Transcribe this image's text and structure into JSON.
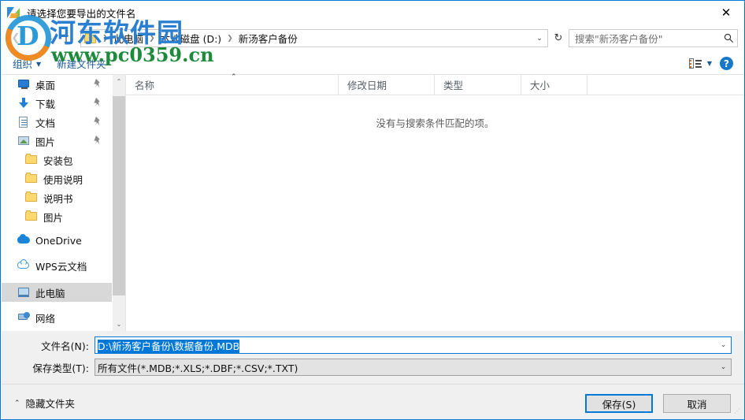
{
  "window": {
    "title": "请选择您要导出的文件名",
    "close_label": "✕",
    "app_icon": "app-icon"
  },
  "address_bar": {
    "back_icon": "back-arrow-icon",
    "forward_icon": "forward-arrow-icon",
    "recent_icon": "recent-locations-icon",
    "up_icon": "up-arrow-icon",
    "folder_icon": "folder-icon",
    "breadcrumbs": [
      "此电脑",
      "本地磁盘 (D:)",
      "新汤客户备份"
    ],
    "separator": "❯",
    "dropdown_icon": "chevron-down-icon",
    "refresh_icon": "refresh-icon",
    "refresh_glyph": "↻"
  },
  "search": {
    "placeholder": "搜索\"新汤客户备份\"",
    "icon": "search-icon",
    "glyph": "⌕"
  },
  "toolbar": {
    "organize_label": "组织",
    "organize_caret": "▼",
    "new_folder_label": "新建文件夹",
    "view_icon": "view-layout-icon",
    "view_caret": "▼",
    "help_label": "?",
    "help_icon": "help-icon"
  },
  "sidebar": {
    "items": [
      {
        "label": "桌面",
        "icon": "desktop-icon",
        "pinned": true,
        "indent": 1,
        "selected": false
      },
      {
        "label": "下载",
        "icon": "download-icon",
        "pinned": true,
        "indent": 1,
        "selected": false
      },
      {
        "label": "文档",
        "icon": "documents-icon",
        "pinned": true,
        "indent": 1,
        "selected": false
      },
      {
        "label": "图片",
        "icon": "pictures-icon",
        "pinned": true,
        "indent": 1,
        "selected": false
      },
      {
        "label": "安装包",
        "icon": "folder-icon",
        "pinned": false,
        "indent": 2,
        "selected": false
      },
      {
        "label": "使用说明",
        "icon": "folder-icon",
        "pinned": false,
        "indent": 2,
        "selected": false
      },
      {
        "label": "说明书",
        "icon": "folder-icon",
        "pinned": false,
        "indent": 2,
        "selected": false
      },
      {
        "label": "图片",
        "icon": "folder-icon",
        "pinned": false,
        "indent": 2,
        "selected": false
      },
      {
        "label": "OneDrive",
        "icon": "onedrive-icon",
        "pinned": false,
        "indent": 1,
        "selected": false
      },
      {
        "label": "WPS云文档",
        "icon": "wps-cloud-icon",
        "pinned": false,
        "indent": 1,
        "selected": false
      },
      {
        "label": "此电脑",
        "icon": "this-pc-icon",
        "pinned": false,
        "indent": 1,
        "selected": true
      },
      {
        "label": "网络",
        "icon": "network-icon",
        "pinned": false,
        "indent": 1,
        "selected": false
      }
    ],
    "pin_glyph": "📌",
    "scroll_up_glyph": "⌃",
    "scroll_down_glyph": "⌄"
  },
  "filelist": {
    "columns": [
      {
        "label": "名称",
        "key": "col-name"
      },
      {
        "label": "修改日期",
        "key": "col-date"
      },
      {
        "label": "类型",
        "key": "col-type"
      },
      {
        "label": "大小",
        "key": "col-size"
      }
    ],
    "sort_caret": "⌃",
    "empty_message": "没有与搜索条件匹配的项。",
    "rows": []
  },
  "form": {
    "filename_label": "文件名(N):",
    "filename_value": "D:\\新汤客户备份\\数据备份.MDB",
    "filename_selected": true,
    "filetype_label": "保存类型(T):",
    "filetype_value": "所有文件(*.MDB;*.XLS;*.DBF;*.CSV;*.TXT)",
    "dropdown_glyph": "⌄"
  },
  "footer": {
    "hide_folders_label": "隐藏文件夹",
    "hide_folders_caret": "⌃",
    "save_label": "保存(S)",
    "cancel_label": "取消"
  },
  "watermark": {
    "chinese": "河东软件园",
    "url": "www.pc0359.cn",
    "logo_letter": "D"
  },
  "colors": {
    "accent": "#0078d7",
    "selection": "#0078d7",
    "chrome_bg": "#f0f0f0",
    "link": "#1a5a96",
    "sidebar_selected": "#d8d8d8"
  }
}
